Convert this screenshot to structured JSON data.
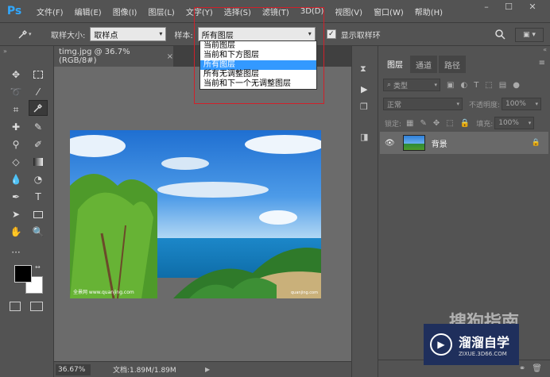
{
  "menubar": {
    "logo": "Ps",
    "items": [
      "文件(F)",
      "编辑(E)",
      "图像(I)",
      "图层(L)",
      "文字(Y)",
      "选择(S)",
      "滤镜(T)",
      "3D(D)",
      "视图(V)",
      "窗口(W)",
      "帮助(H)"
    ],
    "controls": [
      "–",
      "☐",
      "✕"
    ]
  },
  "options": {
    "sample_size_label": "取样大小:",
    "sample_size_value": "取样点",
    "sample_label": "样本:",
    "sample_value": "所有图层",
    "show_ring_label": "显示取样环",
    "show_ring_checked": true
  },
  "sample_dropdown": {
    "options": [
      "当前图层",
      "当前和下方图层",
      "所有图层",
      "所有无调整图层",
      "当前和下一个无调整图层"
    ],
    "selected_index": 2
  },
  "document": {
    "tab_title": "timg.jpg @ 36.7%(RGB/8#)",
    "tab_close": "×",
    "image_caption_left": "全景网   www.quanjing.com",
    "image_caption_right": "quanjing.com"
  },
  "statusbar": {
    "zoom": "36.67%",
    "doc_info": "文档:1.89M/1.89M"
  },
  "layers_panel": {
    "tabs": [
      "图层",
      "通道",
      "路径"
    ],
    "active_tab": 0,
    "filter_kind": "类型",
    "blend_mode": "正常",
    "opacity_label": "不透明度:",
    "opacity_value": "100%",
    "lock_label": "锁定:",
    "fill_label": "填充:",
    "fill_value": "100%",
    "layers": [
      {
        "name": "背景",
        "visible": true,
        "locked": true
      }
    ]
  },
  "watermark": {
    "line1": "搜狗指南",
    "brand": "溜溜自学",
    "site": "ZIXUE.3D66.COM"
  }
}
